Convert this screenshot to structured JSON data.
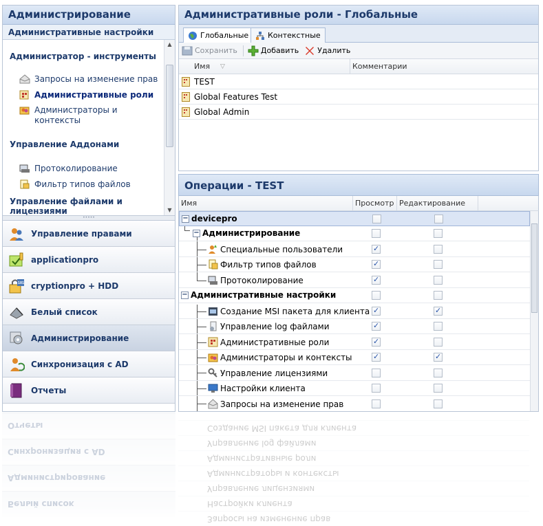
{
  "left": {
    "title": "Администрирование",
    "subtitle": "Административные настройки",
    "groups": [
      {
        "label": "Администратор - инструменты"
      },
      {
        "label": "Управление Аддонами"
      },
      {
        "label": "Управление файлами и лицензиями"
      }
    ],
    "items": [
      {
        "label": "Запросы на изменение прав",
        "icon": "request-icon"
      },
      {
        "label": "Административные роли",
        "icon": "roles-icon",
        "selected": true
      },
      {
        "label": "Администраторы и",
        "label2": "контексты",
        "icon": "admins-icon"
      },
      {
        "label": "Протоколирование",
        "icon": "log-icon"
      },
      {
        "label": "Фильтр типов файлов",
        "icon": "file-filter-icon"
      }
    ],
    "nav": [
      {
        "label": "Управление правами",
        "icon": "rights-icon"
      },
      {
        "label": "applicationpro",
        "icon": "application-icon"
      },
      {
        "label": "cryptionpro + HDD",
        "icon": "crypt-icon"
      },
      {
        "label": "Белый список",
        "icon": "whitelist-icon"
      },
      {
        "label": "Администрирование",
        "icon": "admin-icon",
        "active": true
      },
      {
        "label": "Синхронизация с AD",
        "icon": "sync-icon"
      },
      {
        "label": "Отчеты",
        "icon": "reports-icon"
      }
    ]
  },
  "roles": {
    "title": "Административные роли - Глобальные",
    "tabs": [
      {
        "label": "Глобальные",
        "active": true
      },
      {
        "label": "Контекстные",
        "active": false
      }
    ],
    "toolbar": {
      "save": "Сохранить",
      "add": "Добавить",
      "delete": "Удалить"
    },
    "columns": {
      "name": "Имя",
      "comment": "Комментарии"
    },
    "rows": [
      "TEST",
      "Global Features Test",
      "Global Admin"
    ]
  },
  "ops": {
    "title": "Операции - TEST",
    "columns": {
      "name": "Имя",
      "view": "Просмотр",
      "edit": "Редактирование"
    },
    "rows": [
      {
        "label": "devicepro",
        "view": false,
        "edit": false
      },
      {
        "label": "Администрирование",
        "view": false,
        "edit": false
      },
      {
        "label": "Специальные пользователи",
        "view": true,
        "edit": false
      },
      {
        "label": "Фильтр типов файлов",
        "view": true,
        "edit": false
      },
      {
        "label": "Протоколирование",
        "view": true,
        "edit": false
      },
      {
        "label": "Административные настройки",
        "view": false,
        "edit": false
      },
      {
        "label": "Создание MSI пакета для клиента",
        "view": true,
        "edit": true
      },
      {
        "label": "Управление log файлами",
        "view": true,
        "edit": false
      },
      {
        "label": "Административные роли",
        "view": true,
        "edit": false
      },
      {
        "label": "Администраторы и контексты",
        "view": true,
        "edit": true
      },
      {
        "label": "Управление лицензиями",
        "view": false,
        "edit": false
      },
      {
        "label": "Настройки клиента",
        "view": false,
        "edit": false
      },
      {
        "label": "Запросы на изменение прав",
        "view": false,
        "edit": false
      }
    ]
  }
}
